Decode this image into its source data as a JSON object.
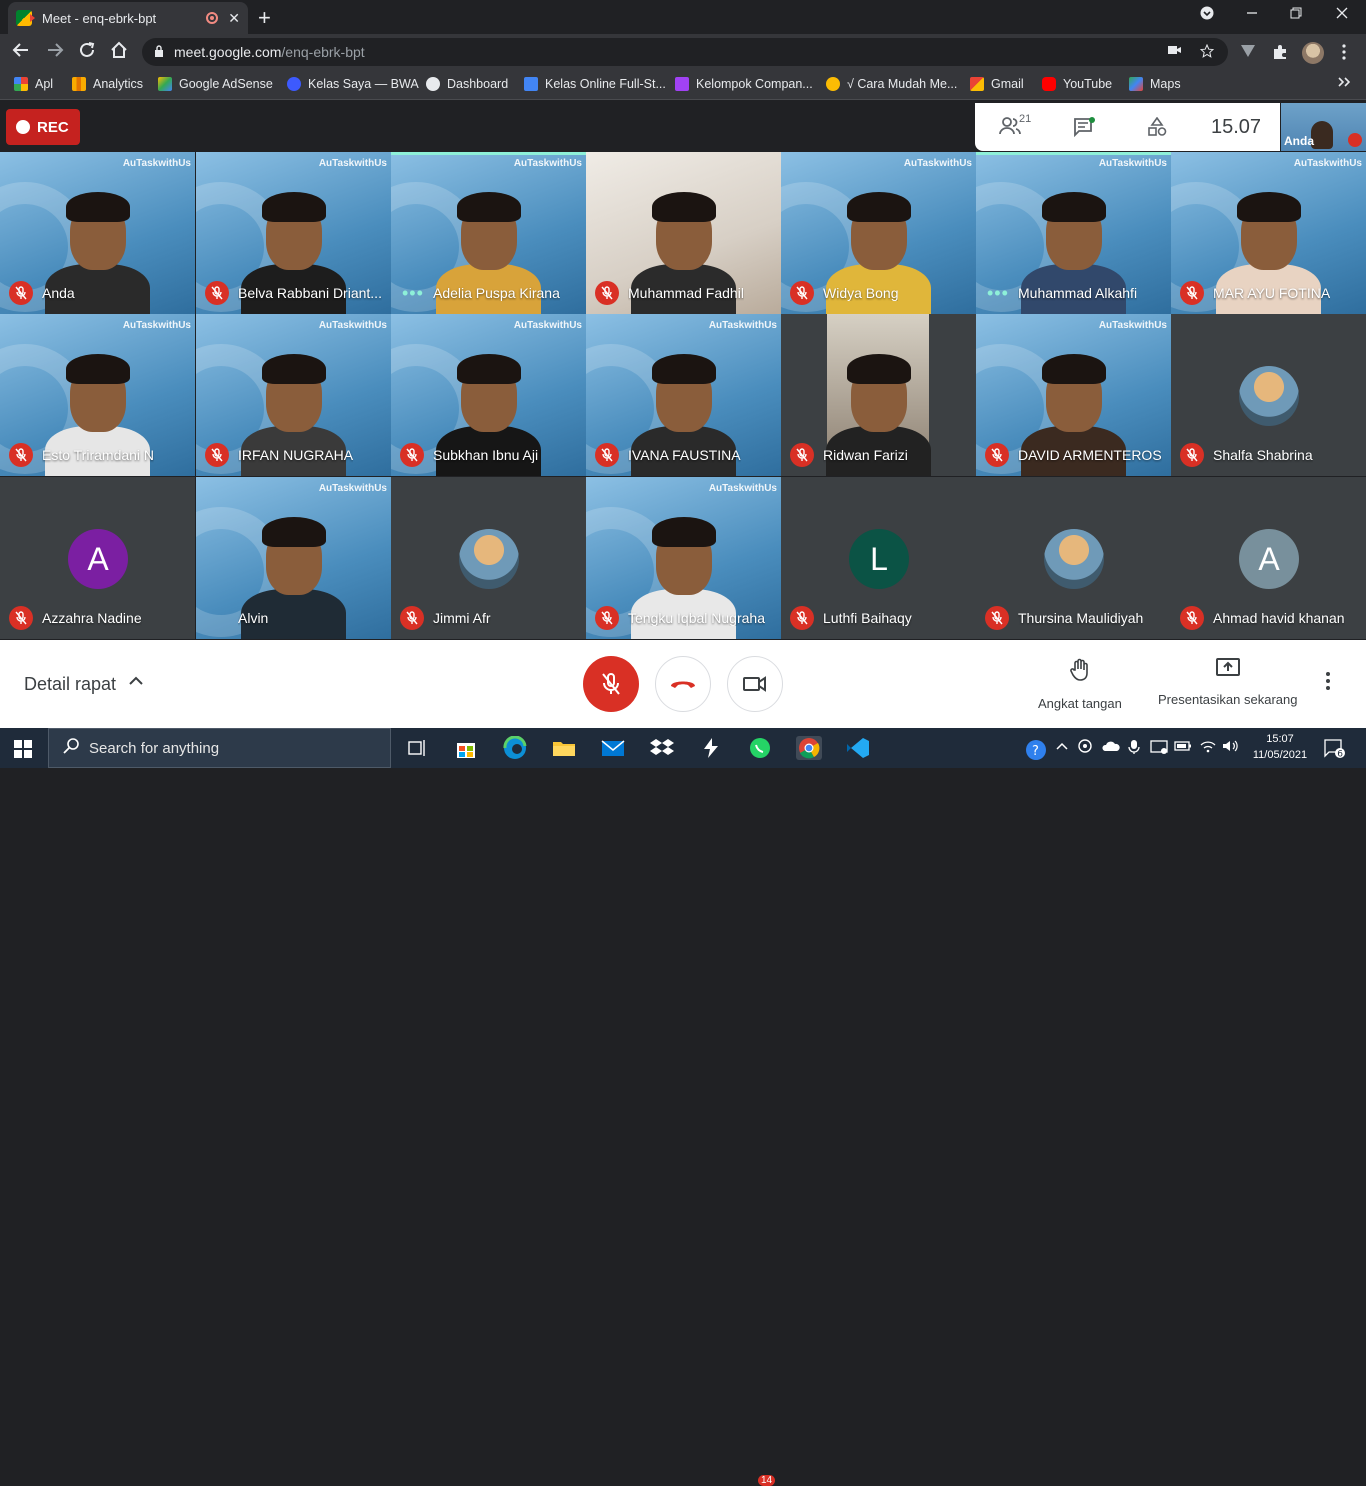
{
  "browser": {
    "tab_title": "Meet - enq-ebrk-bpt",
    "tab_close": "✕",
    "new_tab": "+",
    "url_host": "meet.google.com",
    "url_path": "/enq-ebrk-bpt"
  },
  "bookmarks": [
    {
      "label": "Apl",
      "color": "#ea4335"
    },
    {
      "label": "Analytics",
      "color": "#f9ab00"
    },
    {
      "label": "Google AdSense",
      "color": "#fbbc04"
    },
    {
      "label": "Kelas Saya — BWA",
      "color": "#3d5afe"
    },
    {
      "label": "Dashboard",
      "color": "#e8eaed"
    },
    {
      "label": "Kelas Online Full-St...",
      "color": "#4285f4"
    },
    {
      "label": "Kelompok Compan...",
      "color": "#a142f4"
    },
    {
      "label": "√ Cara Mudah Me...",
      "color": "#fbbc04"
    },
    {
      "label": "Gmail",
      "color": "#ea4335"
    },
    {
      "label": "YouTube",
      "color": "#ff0000"
    },
    {
      "label": "Maps",
      "color": "#34a853"
    }
  ],
  "meet": {
    "rec_label": "REC",
    "people_count": "21",
    "time": "15.07",
    "self_label": "Anda"
  },
  "participants": [
    {
      "name": "Anda",
      "kind": "video",
      "state": "muted"
    },
    {
      "name": "Belva Rabbani Driant...",
      "kind": "video",
      "state": "muted"
    },
    {
      "name": "Adelia Puspa Kirana",
      "kind": "video",
      "state": "speaking"
    },
    {
      "name": "Muhammad Fadhil",
      "kind": "room",
      "state": "muted"
    },
    {
      "name": "Widya Bong",
      "kind": "video",
      "state": "muted"
    },
    {
      "name": "Muhammad Alkahfi",
      "kind": "video",
      "state": "speaking"
    },
    {
      "name": "MAR AYU FOTINA",
      "kind": "video",
      "state": "muted"
    },
    {
      "name": "Esto Triramdani N",
      "kind": "video",
      "state": "muted"
    },
    {
      "name": "IRFAN NUGRAHA",
      "kind": "video",
      "state": "muted"
    },
    {
      "name": "Subkhan Ibnu Aji",
      "kind": "video",
      "state": "muted"
    },
    {
      "name": "IVANA FAUSTINA",
      "kind": "video",
      "state": "muted"
    },
    {
      "name": "Ridwan Farizi",
      "kind": "portrait",
      "state": "muted"
    },
    {
      "name": "DAVID ARMENTEROS",
      "kind": "video",
      "state": "muted"
    },
    {
      "name": "Shalfa Shabrina",
      "kind": "photo",
      "state": "muted"
    },
    {
      "name": "Azzahra Nadine",
      "kind": "letter",
      "letter": "A",
      "color": "#7b1fa2",
      "state": "muted"
    },
    {
      "name": "Alvin",
      "kind": "video",
      "state": "none"
    },
    {
      "name": "Jimmi Afr",
      "kind": "photo",
      "state": "muted"
    },
    {
      "name": "Tengku Iqbal Nugraha",
      "kind": "video",
      "state": "muted"
    },
    {
      "name": "Luthfi Baihaqy",
      "kind": "letter",
      "letter": "L",
      "color": "#0b5345",
      "state": "muted"
    },
    {
      "name": "Thursina Maulidiyah",
      "kind": "photo",
      "state": "muted"
    },
    {
      "name": "Ahmad havid khanan",
      "kind": "letter",
      "letter": "A",
      "color": "#78909c",
      "state": "muted"
    }
  ],
  "brand_text": "AuTaskwithUs",
  "controls": {
    "detail_label": "Detail rapat",
    "raise_hand_label": "Angkat tangan",
    "present_label": "Presentasikan sekarang"
  },
  "taskbar": {
    "search_placeholder": "Search for anything",
    "time": "15:07",
    "date": "11/05/2021",
    "whatsapp_badge": "14",
    "notif_count": "6"
  },
  "colors": {
    "rec": "#c5221f",
    "mic_off": "#d93025",
    "speaking": "#8ef0d8"
  }
}
